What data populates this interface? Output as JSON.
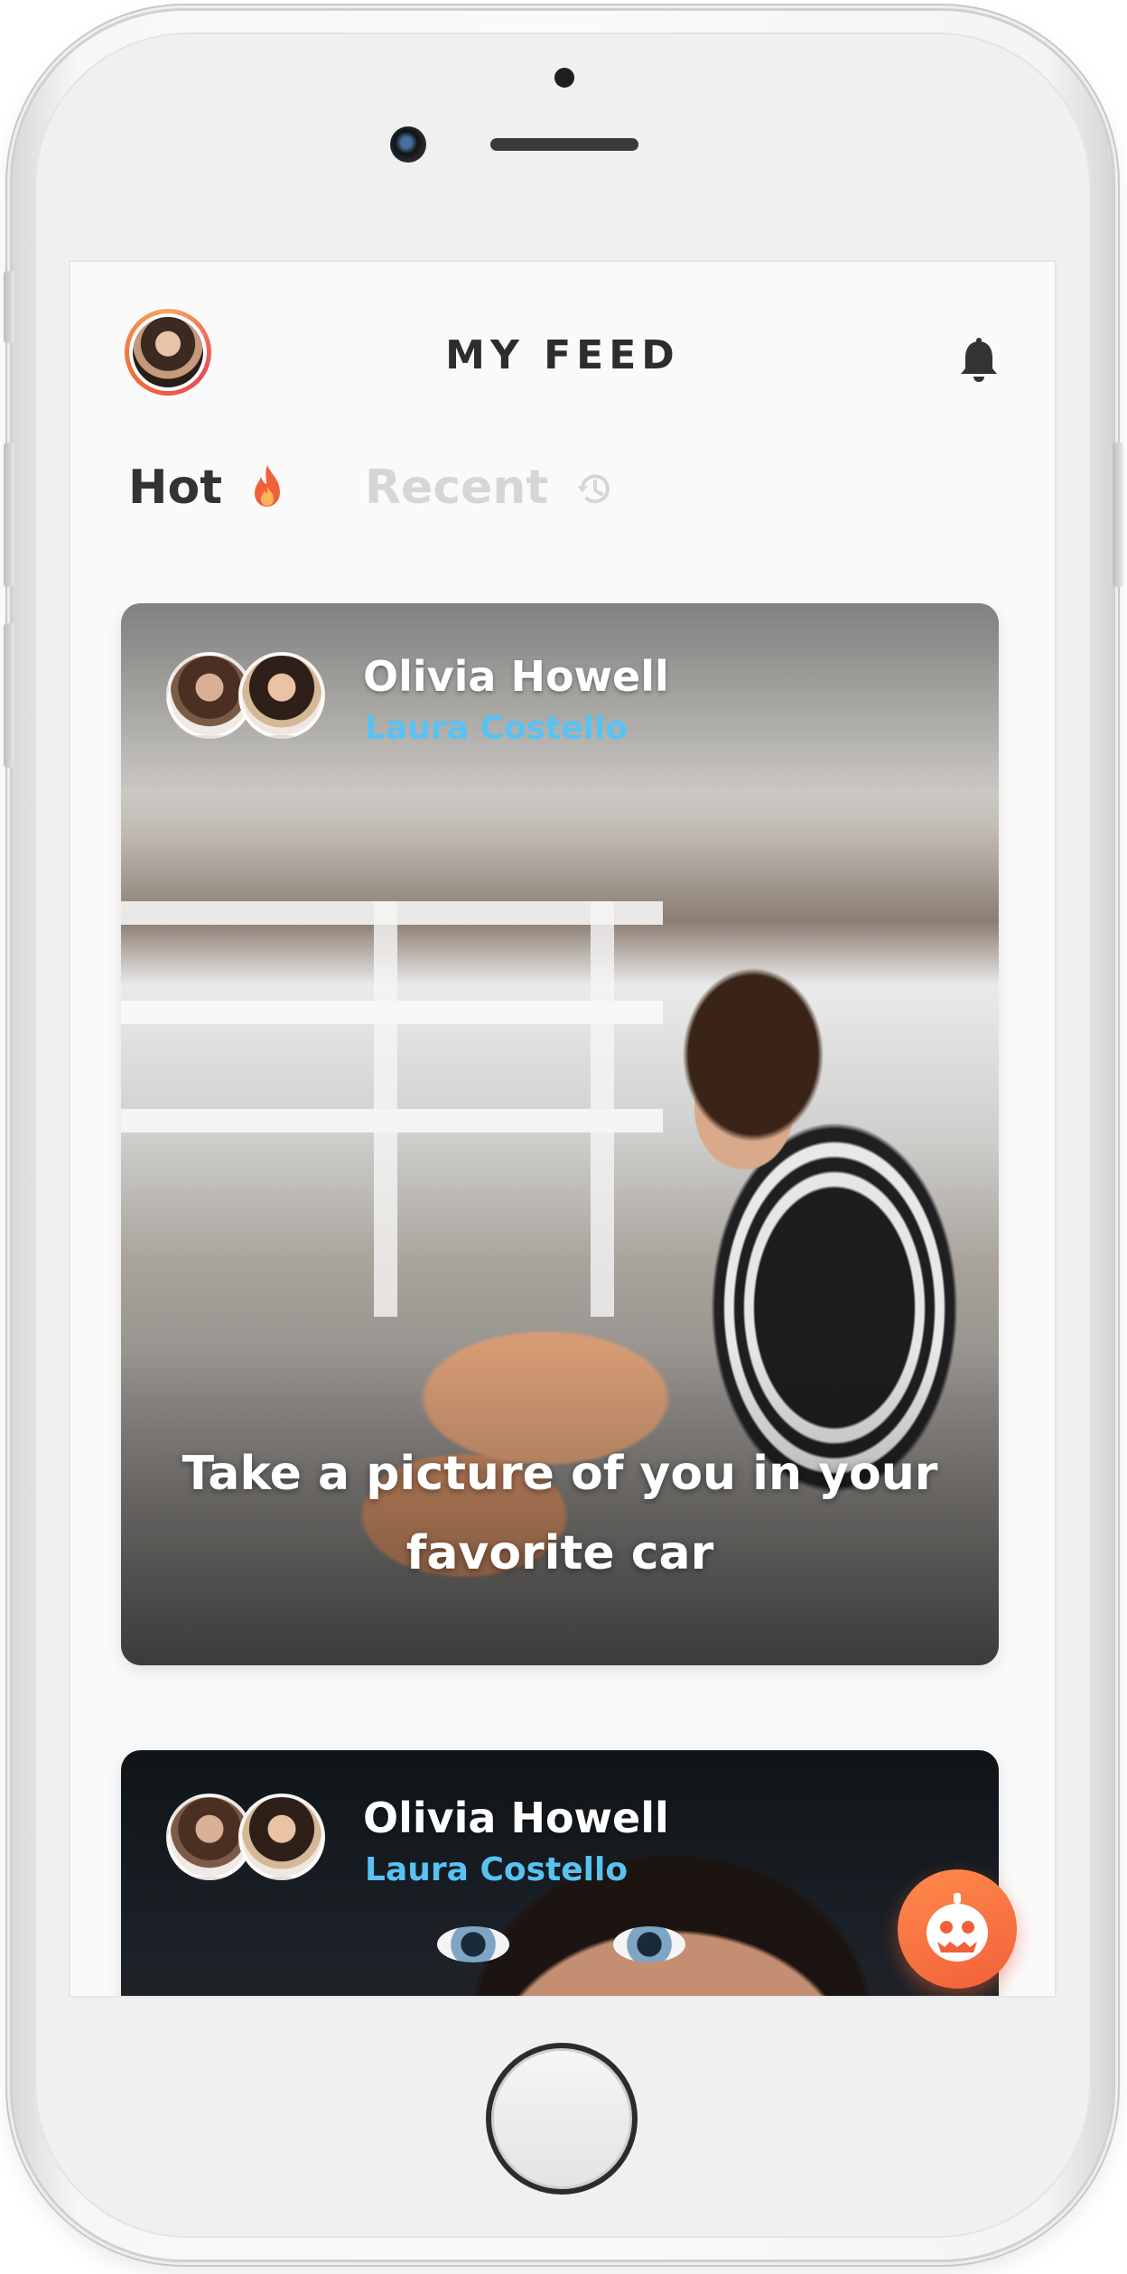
{
  "header": {
    "title": "MY FEED"
  },
  "tabs": [
    {
      "label": "Hot",
      "icon": "flame-icon",
      "active": true
    },
    {
      "label": "Recent",
      "icon": "history-icon",
      "active": false
    }
  ],
  "cards": [
    {
      "author": "Olivia Howell",
      "tagged": "Laura Costello",
      "caption": "Take a picture of you in your favorite car"
    },
    {
      "author": "Olivia Howell",
      "tagged": "Laura Costello"
    }
  ],
  "colors": {
    "accent_orange": "#f2603a",
    "link_blue": "#58c3f3",
    "title_dark": "#2d2d30",
    "tab_inactive": "#d6d6d8"
  }
}
